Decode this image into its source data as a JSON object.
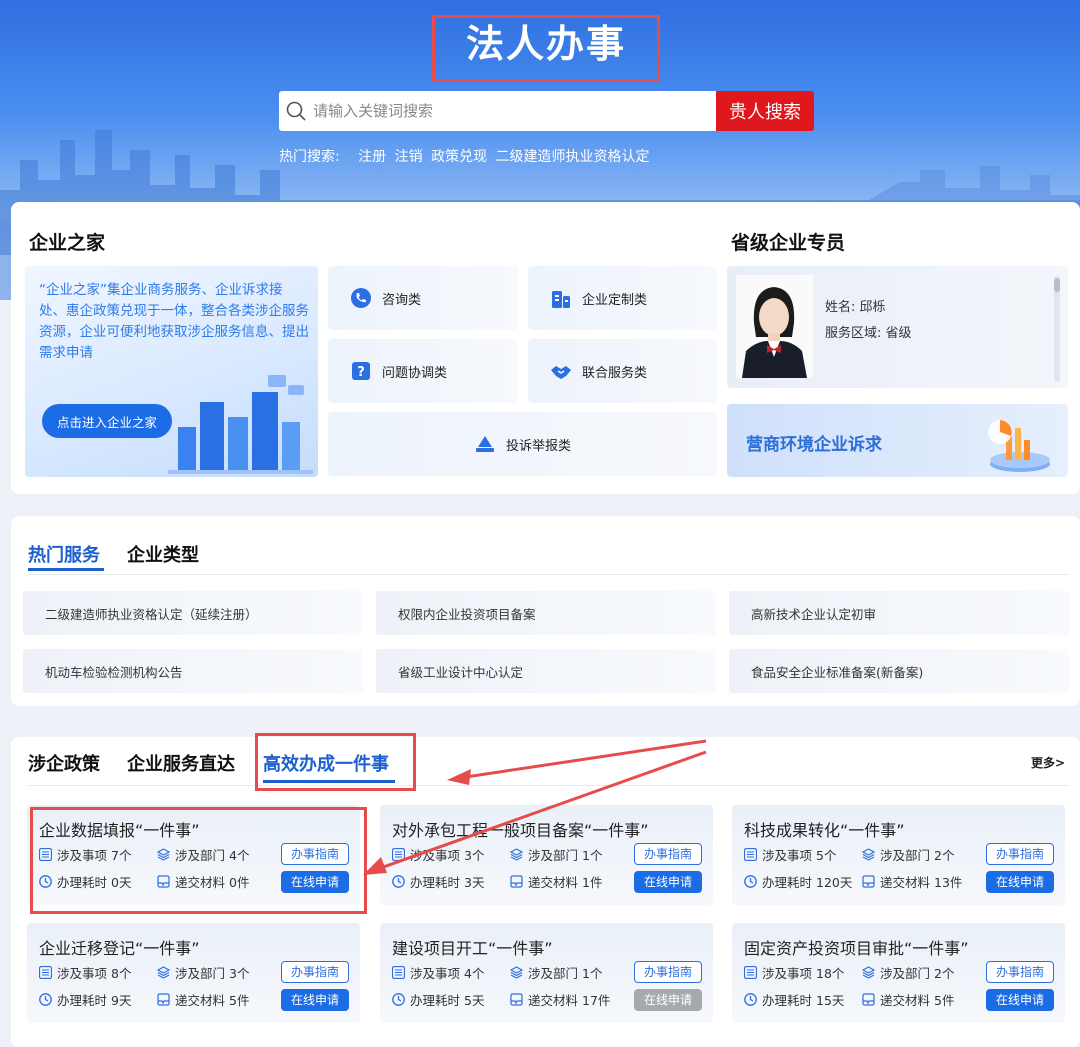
{
  "header": {
    "title": "法人办事",
    "search_placeholder": "请输入关键词搜索",
    "search_button": "贵人搜索",
    "hot_label": "热门搜索:",
    "hot_terms": [
      "注册",
      "注销",
      "政策兑现",
      "二级建造师执业资格认定"
    ]
  },
  "enterprise_home": {
    "title": "企业之家",
    "intro": "“企业之家”集企业商务服务、企业诉求接处、惠企政策兑现于一体，整合各类涉企服务资源，企业可便利地获取涉企服务信息、提出需求申请",
    "enter_button": "点击进入企业之家",
    "categories": [
      {
        "label": "咨询类",
        "icon": "phone-icon"
      },
      {
        "label": "企业定制类",
        "icon": "building-icon"
      },
      {
        "label": "问题协调类",
        "icon": "question-icon"
      },
      {
        "label": "联合服务类",
        "icon": "handshake-icon"
      },
      {
        "label": "投诉举报类",
        "icon": "report-icon"
      }
    ]
  },
  "commissioner": {
    "title": "省级企业专员",
    "name_label": "姓名:",
    "name": "邱栎",
    "area_label": "服务区域:",
    "area": "省级",
    "appeal_label": "营商环境企业诉求"
  },
  "hot_services": {
    "tabs": [
      "热门服务",
      "企业类型"
    ],
    "items": [
      "二级建造师执业资格认定（延续注册）",
      "权限内企业投资项目备案",
      "高新技术企业认定初审",
      "机动车检验检测机构公告",
      "省级工业设计中心认定",
      "食品安全企业标准备案(新备案)"
    ]
  },
  "bottom": {
    "tabs": [
      "涉企政策",
      "企业服务直达",
      "高效办成一件事"
    ],
    "more": "更多>",
    "labels": {
      "items": "涉及事项",
      "depts": "涉及部门",
      "time": "办理耗时",
      "materials": "递交材料",
      "guide": "办事指南",
      "apply": "在线申请"
    },
    "cards": [
      {
        "title": "企业数据填报“一件事”",
        "items": "7个",
        "depts": "4个",
        "time": "0天",
        "materials": "0件",
        "apply_enabled": true
      },
      {
        "title": "对外承包工程一般项目备案“一件事”",
        "items": "3个",
        "depts": "1个",
        "time": "3天",
        "materials": "1件",
        "apply_enabled": true
      },
      {
        "title": "科技成果转化“一件事”",
        "items": "5个",
        "depts": "2个",
        "time": "120天",
        "materials": "13件",
        "apply_enabled": true
      },
      {
        "title": "企业迁移登记“一件事”",
        "items": "8个",
        "depts": "3个",
        "time": "9天",
        "materials": "5件",
        "apply_enabled": true
      },
      {
        "title": "建设项目开工“一件事”",
        "items": "4个",
        "depts": "1个",
        "time": "5天",
        "materials": "17件",
        "apply_enabled": false
      },
      {
        "title": "固定资产投资项目审批“一件事”",
        "items": "18个",
        "depts": "2个",
        "time": "15天",
        "materials": "5件",
        "apply_enabled": true
      }
    ]
  },
  "colors": {
    "brand_blue": "#1c6ce5",
    "search_red": "#e0171d",
    "annotation_red": "#e74c4c",
    "disabled_gray": "#a6a9ae"
  }
}
